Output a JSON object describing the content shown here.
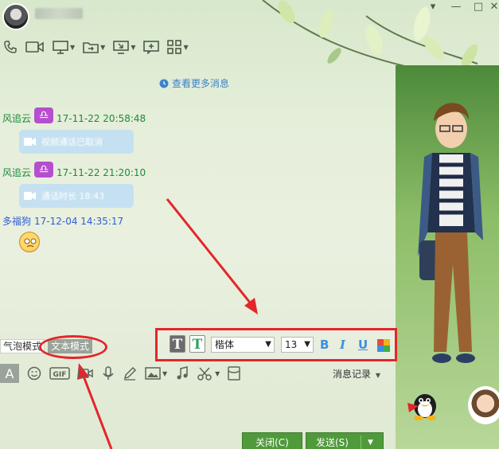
{
  "header": {
    "close_label": "✕",
    "minimize_label": "▾",
    "maximize_label": "□"
  },
  "toolbar": {
    "icons": [
      "phone-icon",
      "video-icon",
      "screen-share-icon",
      "file-transfer-icon",
      "remote-desktop-icon",
      "app-add-icon",
      "apps-grid-icon"
    ]
  },
  "chat": {
    "more_messages": "查看更多消息",
    "messages": [
      {
        "sender": "风追云",
        "time": "17-11-22 20:58:48",
        "bubble": "视频通话已取消"
      },
      {
        "sender": "风追云",
        "time": "17-11-22 21:20:10",
        "bubble": "通话时长 18:43"
      },
      {
        "sender": "多福狗",
        "time": "17-12-04 14:35:17"
      }
    ],
    "zodiac_glyph": "♎"
  },
  "mode_switch": {
    "bubble_mode": "气泡模式",
    "text_mode": "文本模式"
  },
  "format_bar": {
    "font_name": "楷体",
    "font_size": "13",
    "bold": "B",
    "italic": "I",
    "underline": "U",
    "text_glyph": "T",
    "dropdown_arrow": "▼"
  },
  "input_toolbar": {
    "history_label": "消息记录"
  },
  "buttons": {
    "close": "关闭(C)",
    "send": "发送(S)",
    "send_arrow": "▼"
  },
  "colors": {
    "accent_green": "#4f9a3a",
    "link_blue": "#3a83c9",
    "sender_green": "#1f8a3d",
    "sender_blue": "#2f5fd0",
    "annotation_red": "#e3262a"
  }
}
